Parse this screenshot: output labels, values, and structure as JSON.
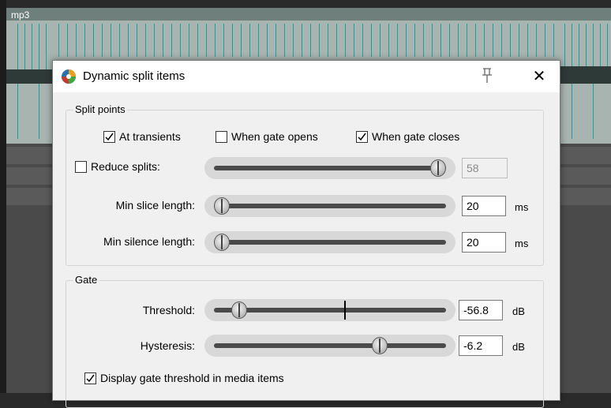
{
  "background": {
    "track_label": "mp3"
  },
  "dialog": {
    "title": "Dynamic split items",
    "app_icon": "reaper-icon",
    "pin_icon": "pin-icon",
    "close_glyph": "✕",
    "split_points": {
      "group_label": "Split points",
      "at_transients": {
        "label": "At transients",
        "checked": true
      },
      "when_gate_opens": {
        "label": "When gate opens",
        "checked": false
      },
      "when_gate_closes": {
        "label": "When gate closes",
        "checked": true
      },
      "reduce_splits": {
        "label": "Reduce splits:",
        "checked": false,
        "value": "58",
        "slider_fraction": 1.0
      },
      "min_slice_length": {
        "label": "Min slice length:",
        "value": "20",
        "unit": "ms",
        "slider_fraction": 0.0
      },
      "min_silence_length": {
        "label": "Min silence length:",
        "value": "20",
        "unit": "ms",
        "slider_fraction": 0.0
      }
    },
    "gate": {
      "group_label": "Gate",
      "threshold": {
        "label": "Threshold:",
        "value": "-56.8",
        "unit": "dB",
        "slider_fraction": 0.08,
        "marker_fraction": 0.56
      },
      "hysteresis": {
        "label": "Hysteresis:",
        "value": "-6.2",
        "unit": "dB",
        "slider_fraction": 0.73
      },
      "display_gate_threshold": {
        "label": "Display gate threshold in media items",
        "checked": true
      }
    }
  },
  "colors": {
    "track_bg": "#a8b4b0",
    "transient_marker": "#1ea0a0",
    "dialog_bg": "#f0f0f0"
  }
}
